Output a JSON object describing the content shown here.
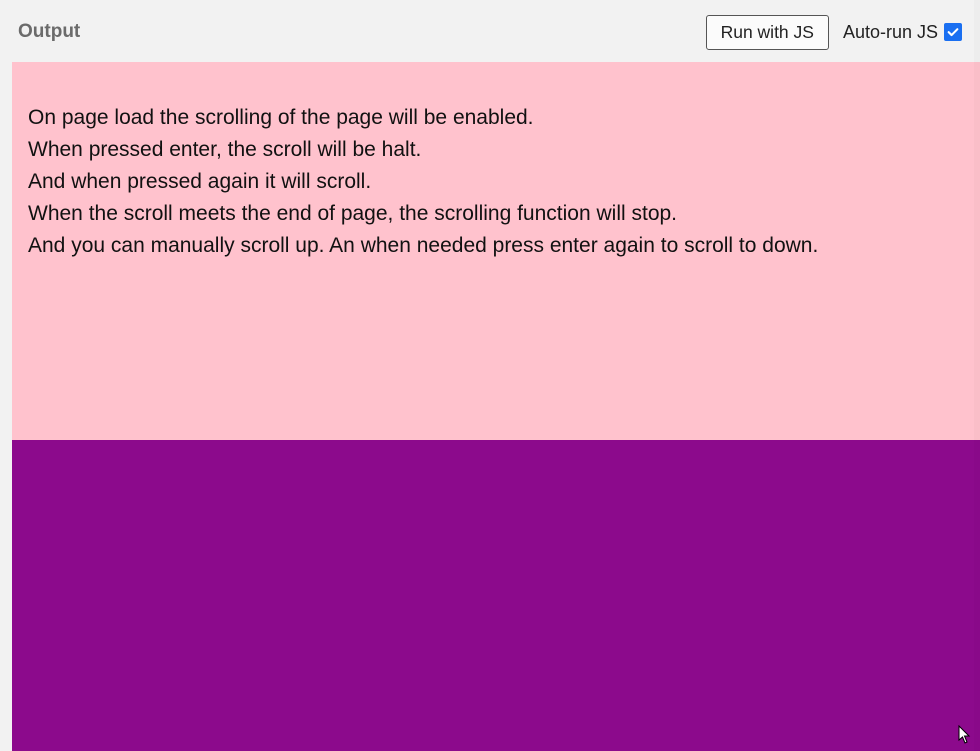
{
  "header": {
    "title": "Output",
    "run_button": "Run with JS",
    "auto_run_label": "Auto-run JS",
    "auto_run_checked": true
  },
  "content": {
    "lines": [
      "On page load the scrolling of the page will be enabled.",
      "When pressed enter, the scroll will be halt.",
      "And when pressed again it will scroll.",
      "When the scroll meets the end of page, the scrolling function will stop.",
      "And you can manually scroll up. An when needed press enter again to scroll to down."
    ]
  },
  "colors": {
    "section1": "#ffc2cd",
    "section2": "#8c0a8c",
    "toolbar_bg": "#f2f2f2",
    "checkbox": "#1a6ff1"
  }
}
